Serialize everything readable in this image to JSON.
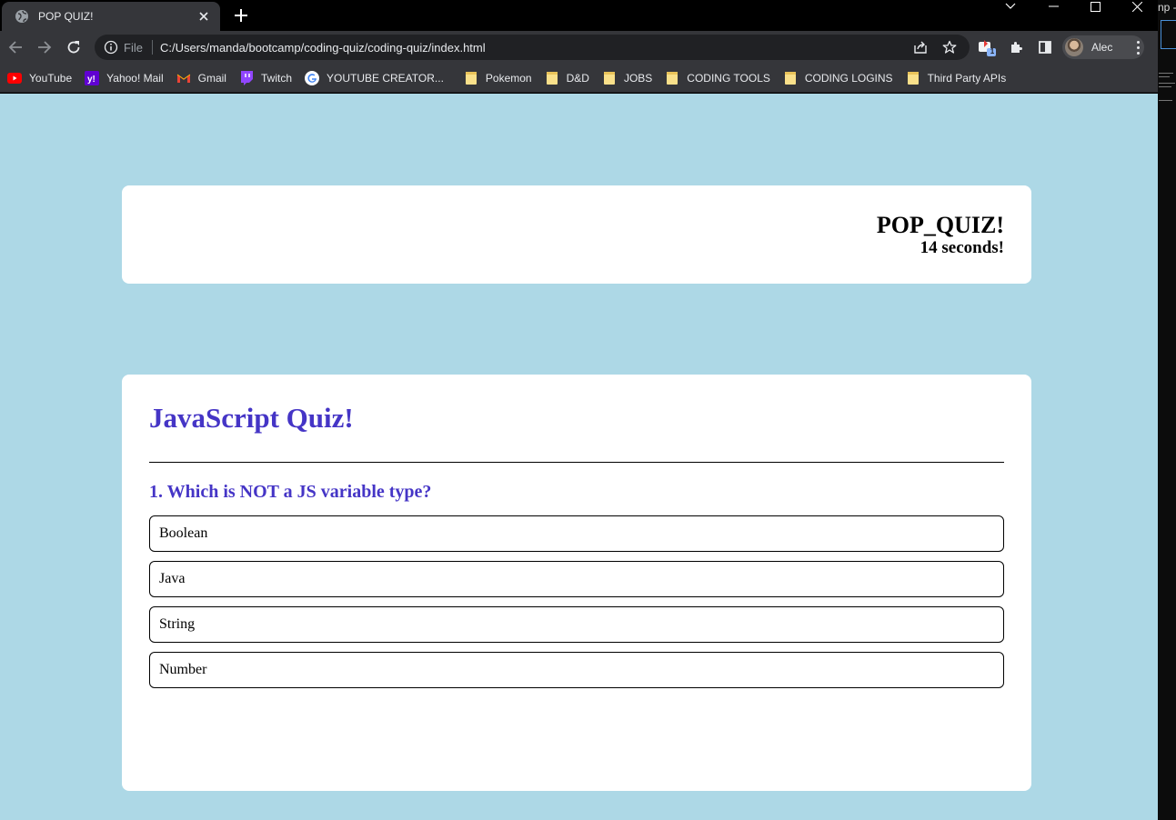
{
  "browser": {
    "tab_title": "POP QUIZ!",
    "new_tab_symbol": "+",
    "omnibox": {
      "scheme_label": "File",
      "url": "C:/Users/manda/bootcamp/coding-quiz/coding-quiz/index.html"
    },
    "extension_badge": "1",
    "profile_name": "Alec",
    "bookmarks": [
      {
        "label": "YouTube",
        "icon": "youtube-icon"
      },
      {
        "label": "Yahoo! Mail",
        "icon": "yahoo-icon"
      },
      {
        "label": "Gmail",
        "icon": "gmail-icon"
      },
      {
        "label": "Twitch",
        "icon": "twitch-icon"
      },
      {
        "label": "YOUTUBE CREATOR...",
        "icon": "google-icon"
      },
      {
        "label": "Pokemon",
        "icon": "folder-icon"
      },
      {
        "label": "D&D",
        "icon": "folder-icon"
      },
      {
        "label": "JOBS",
        "icon": "folder-icon"
      },
      {
        "label": "CODING TOOLS",
        "icon": "folder-icon"
      },
      {
        "label": "CODING LOGINS",
        "icon": "folder-icon"
      },
      {
        "label": "Third Party APIs",
        "icon": "folder-icon"
      }
    ]
  },
  "page": {
    "header": {
      "title": "POP_QUIZ!",
      "timer": "14 seconds!"
    },
    "quiz": {
      "title": "JavaScript Quiz!",
      "question": "1. Which is NOT a JS variable type?",
      "answers": [
        "Boolean",
        "Java",
        "String",
        "Number"
      ]
    }
  },
  "side_window": {
    "visible_text": "np -"
  },
  "colors": {
    "page_background": "#add8e6",
    "accent_purple": "#4535c6",
    "chrome_dark": "#35363a"
  }
}
